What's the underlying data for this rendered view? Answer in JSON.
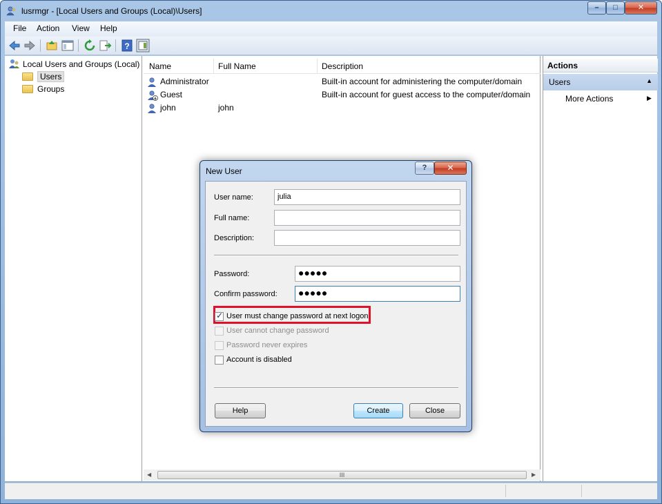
{
  "window": {
    "title": "lusrmgr - [Local Users and Groups (Local)\\Users]",
    "min_glyph": "–",
    "max_glyph": "□",
    "close_glyph": "✕"
  },
  "menu": [
    "File",
    "Action",
    "View",
    "Help"
  ],
  "tree": {
    "root": "Local Users and Groups (Local)",
    "children": [
      "Users",
      "Groups"
    ],
    "selected": "Users"
  },
  "list": {
    "columns": [
      "Name",
      "Full Name",
      "Description"
    ],
    "rows": [
      {
        "name": "Administrator",
        "full_name": "",
        "description": "Built-in account for administering the computer/domain"
      },
      {
        "name": "Guest",
        "full_name": "",
        "description": "Built-in account for guest access to the computer/domain"
      },
      {
        "name": "john",
        "full_name": "john",
        "description": ""
      }
    ],
    "scroll_thumb": "III"
  },
  "actions": {
    "header": "Actions",
    "section": "Users",
    "items": [
      "More Actions"
    ]
  },
  "dialog": {
    "title": "New User",
    "help_glyph": "?",
    "close_glyph": "✕",
    "user_name_label": "User name:",
    "user_name_value": "julia",
    "full_name_label": "Full name:",
    "full_name_value": "",
    "description_label": "Description:",
    "description_value": "",
    "password_label": "Password:",
    "password_value": "●●●●●",
    "confirm_label": "Confirm password:",
    "confirm_value": "●●●●●",
    "checkboxes": [
      {
        "label": "User must change password at next logon",
        "checked": true,
        "enabled": true
      },
      {
        "label": "User cannot change password",
        "checked": false,
        "enabled": false
      },
      {
        "label": "Password never expires",
        "checked": false,
        "enabled": false
      },
      {
        "label": "Account is disabled",
        "checked": false,
        "enabled": true
      }
    ],
    "buttons": {
      "help": "Help",
      "create": "Create",
      "close": "Close"
    }
  },
  "colors": {
    "highlight_box": "#e0102a",
    "selection": "#c9daf0"
  }
}
